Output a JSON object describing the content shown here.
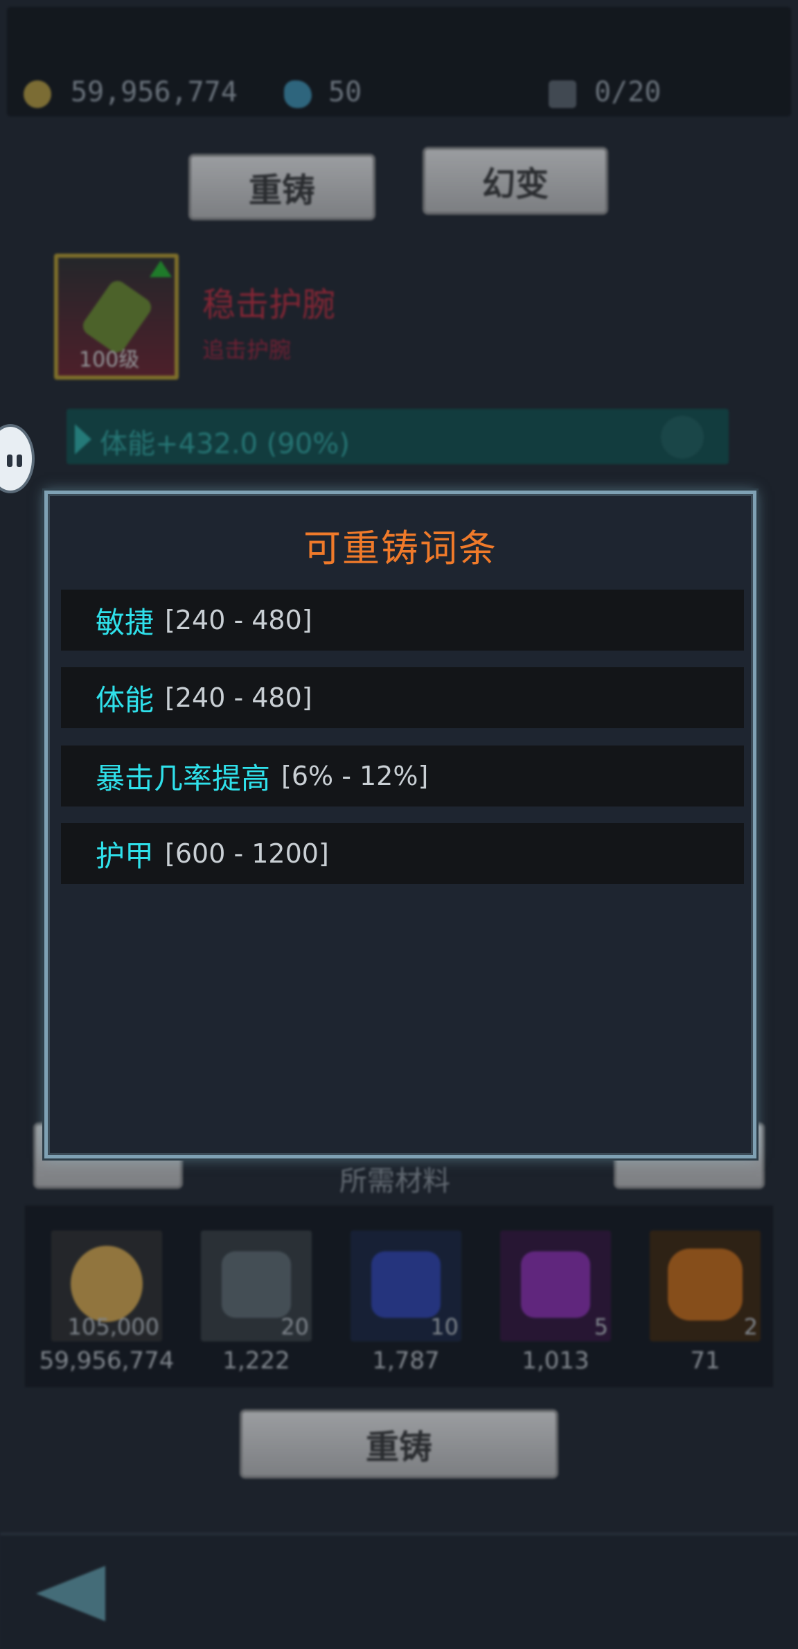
{
  "header": {
    "gold": "59,956,774",
    "gems": "50",
    "capacity": "0/20"
  },
  "buttons": {
    "reforge_tab": "重铸",
    "transform_tab": "幻变",
    "reforge_action": "重铸"
  },
  "item": {
    "level": "100级",
    "name": "稳击护腕",
    "subtitle": "追击护腕"
  },
  "stat_bar": {
    "text": "体能+432.0  (90%)"
  },
  "modal": {
    "title": "可重铸词条",
    "rows": [
      {
        "name": "敏捷",
        "range": "[240  -  480]"
      },
      {
        "name": "体能",
        "range": "[240  -  480]"
      },
      {
        "name": "暴击几率提高",
        "range": "[6%  -  12%]"
      },
      {
        "name": "护甲",
        "range": "[600  -  1200]"
      }
    ]
  },
  "materials": {
    "label": "所需材料",
    "items": [
      {
        "icon": "gold-coin-icon",
        "need": "105,000",
        "have": "59,956,774",
        "color": "#d9a94a"
      },
      {
        "icon": "gray-stone-icon",
        "need": "20",
        "have": "1,222",
        "color": "#5e6a70"
      },
      {
        "icon": "blue-stone-icon",
        "need": "10",
        "have": "1,787",
        "color": "#2b3fb0"
      },
      {
        "icon": "purple-stone-icon",
        "need": "5",
        "have": "1,013",
        "color": "#8a2ab0"
      },
      {
        "icon": "orange-stone-icon",
        "need": "2",
        "have": "71",
        "color": "#c86a12"
      }
    ]
  }
}
